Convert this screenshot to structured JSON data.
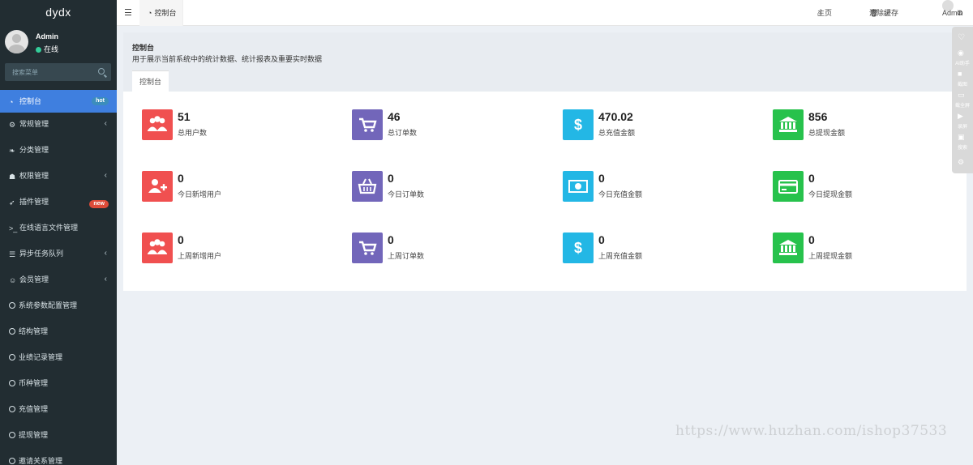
{
  "sidebar": {
    "logo": "dydx",
    "user": {
      "name": "Admin",
      "status": "在线"
    },
    "search_placeholder": "搜索菜单",
    "items": [
      {
        "label": "控制台",
        "badge": "hot"
      },
      {
        "label": "常规管理"
      },
      {
        "label": "分类管理"
      },
      {
        "label": "权限管理"
      },
      {
        "label": "插件管理",
        "badge": "new"
      },
      {
        "label": "在线语言文件管理"
      },
      {
        "label": "异步任务队列"
      },
      {
        "label": "会员管理"
      },
      {
        "label": "系统参数配置管理"
      },
      {
        "label": "结构管理"
      },
      {
        "label": "业绩记录管理"
      },
      {
        "label": "币种管理"
      },
      {
        "label": "充值管理"
      },
      {
        "label": "提现管理"
      },
      {
        "label": "邀请关系管理"
      }
    ]
  },
  "topbar": {
    "tab_label": "控制台",
    "home": "主页",
    "clear_cache": "清除缓存",
    "admin": "Admin"
  },
  "header": {
    "title": "控制台",
    "subtitle": "用于展示当前系统中的统计数据、统计报表及重要实时数据",
    "tab": "控制台"
  },
  "stats": [
    {
      "value": "51",
      "label": "总用户数",
      "icon": "users-icon",
      "color": "#f05050"
    },
    {
      "value": "46",
      "label": "总订单数",
      "icon": "cart-icon",
      "color": "#7266ba"
    },
    {
      "value": "470.02",
      "label": "总充值金额",
      "icon": "dollar-icon",
      "color": "#23b7e5"
    },
    {
      "value": "856",
      "label": "总提现金额",
      "icon": "bank-icon",
      "color": "#27c24c"
    },
    {
      "value": "0",
      "label": "今日新增用户",
      "icon": "user-plus-icon",
      "color": "#f05050"
    },
    {
      "value": "0",
      "label": "今日订单数",
      "icon": "basket-icon",
      "color": "#7266ba"
    },
    {
      "value": "0",
      "label": "今日充值金额",
      "icon": "money-icon",
      "color": "#23b7e5"
    },
    {
      "value": "0",
      "label": "今日提现金额",
      "icon": "credit-card-icon",
      "color": "#27c24c"
    },
    {
      "value": "0",
      "label": "上周新增用户",
      "icon": "users-icon",
      "color": "#f05050"
    },
    {
      "value": "0",
      "label": "上周订单数",
      "icon": "cart-icon",
      "color": "#7266ba"
    },
    {
      "value": "0",
      "label": "上周充值金额",
      "icon": "dollar-icon",
      "color": "#23b7e5"
    },
    {
      "value": "0",
      "label": "上周提现金额",
      "icon": "bank-icon",
      "color": "#27c24c"
    }
  ],
  "right_toolbar": [
    "AI助手",
    "截图",
    "截全屏",
    "录屏",
    "搜索"
  ],
  "watermark": "https://www.huzhan.com/ishop37533"
}
